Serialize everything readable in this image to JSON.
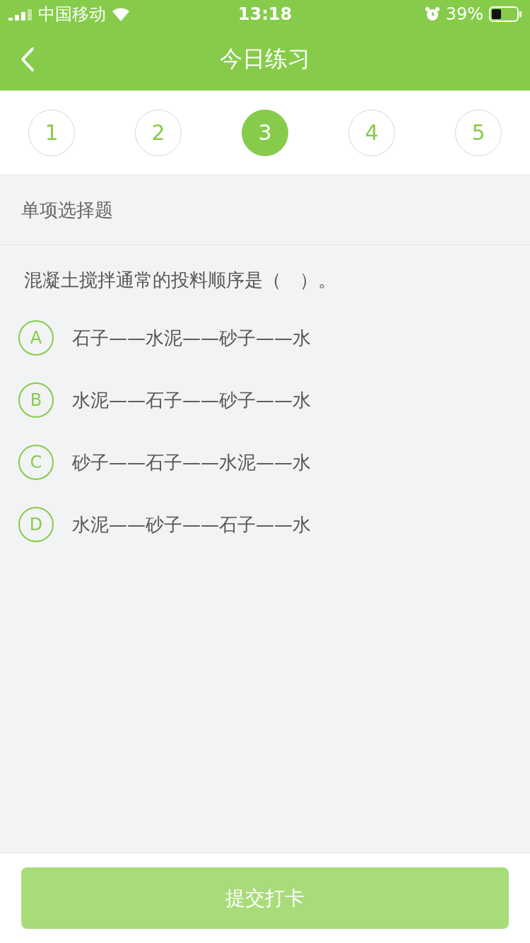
{
  "status_bar": {
    "carrier": "中国移动",
    "time": "13:18",
    "battery": "39%"
  },
  "nav": {
    "title": "今日练习"
  },
  "steps": [
    {
      "label": "1",
      "selected": false
    },
    {
      "label": "2",
      "selected": false
    },
    {
      "label": "3",
      "selected": true
    },
    {
      "label": "4",
      "selected": false
    },
    {
      "label": "5",
      "selected": false
    }
  ],
  "section": "单项选择题",
  "question": "混凝土搅拌通常的投料顺序是（　）。",
  "options": [
    {
      "letter": "A",
      "text": "石子——水泥——砂子——水",
      "selected": false
    },
    {
      "letter": "B",
      "text": "水泥——石子——砂子——水",
      "selected": false
    },
    {
      "letter": "C",
      "text": "砂子——石子——水泥——水",
      "selected": false
    },
    {
      "letter": "D",
      "text": "水泥——砂子——石子——水",
      "selected": false
    }
  ],
  "submit": {
    "label": "提交打卡",
    "disabled": true
  }
}
